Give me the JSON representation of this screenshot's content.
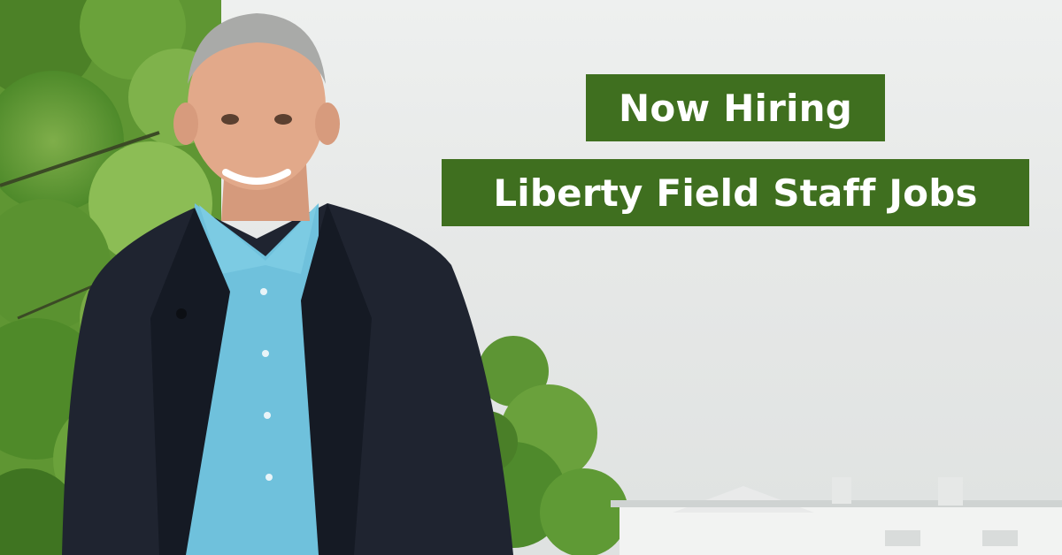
{
  "headline": {
    "line1": "Now Hiring",
    "line2": "Liberty Field Staff Jobs"
  },
  "colors": {
    "banner_green": "#3f6f1f",
    "banner_text": "#ffffff"
  }
}
